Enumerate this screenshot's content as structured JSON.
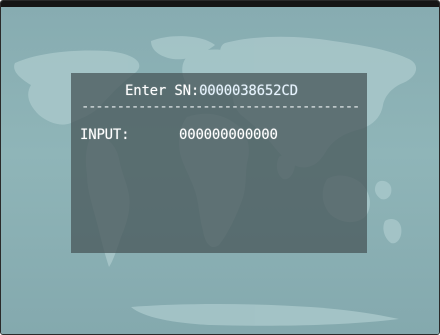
{
  "osd": {
    "title_prefix": "Enter SN:",
    "serial_number": "0000038652CD",
    "separator": "----------------------------------------",
    "input_label": "INPUT:",
    "input_value": "000000000000"
  },
  "colors": {
    "screen_background": "#8fb2b5",
    "map_land": "#a9c8cb",
    "dialog_background": "#4a5a5c",
    "text": "#ffffff"
  },
  "icons": {
    "background": "world-map-icon"
  }
}
